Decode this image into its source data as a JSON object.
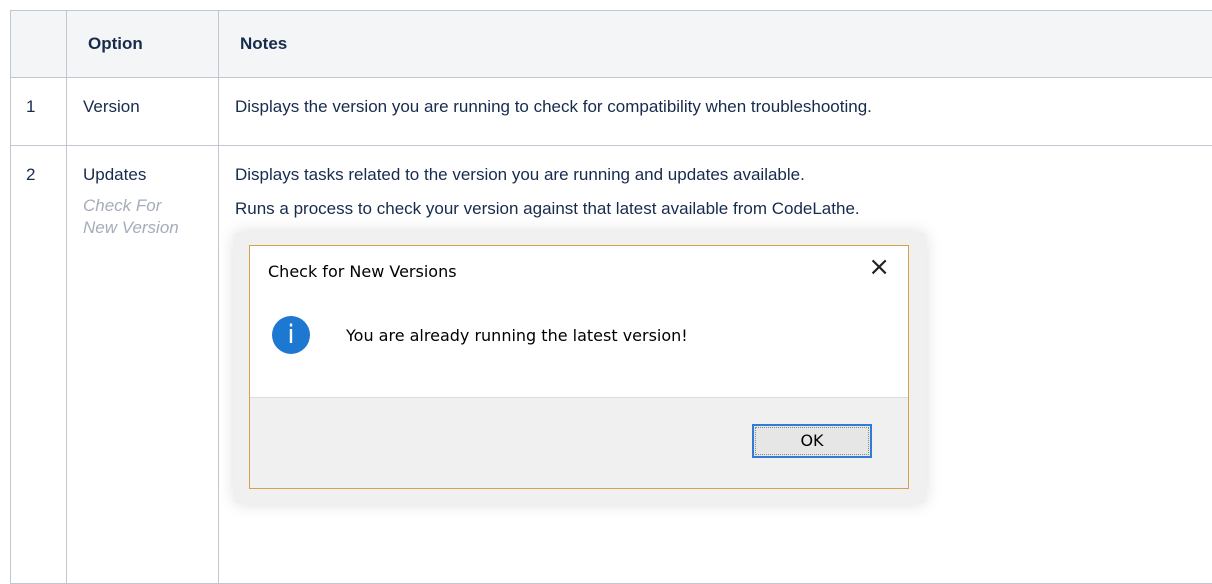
{
  "table": {
    "headers": [
      "",
      "Option",
      "Notes"
    ],
    "rows": [
      {
        "num": "1",
        "option": "Version",
        "sub_option": "",
        "notes": [
          "Displays the version you are running to check for compatibility when troubleshooting."
        ]
      },
      {
        "num": "2",
        "option": "Updates",
        "sub_option": "Check For New Version",
        "notes": [
          "Displays tasks related to the version you are running and updates available.",
          "Runs a process to check your version against that latest available from CodeLathe."
        ]
      }
    ]
  },
  "dialog": {
    "title": "Check for New Versions",
    "close_icon": "close-icon",
    "close_glyph": "×",
    "info_icon": "info-icon",
    "info_glyph": "i",
    "message": "You are already running the latest version!",
    "ok_label": "OK",
    "accent_color": "#1d78d1"
  }
}
